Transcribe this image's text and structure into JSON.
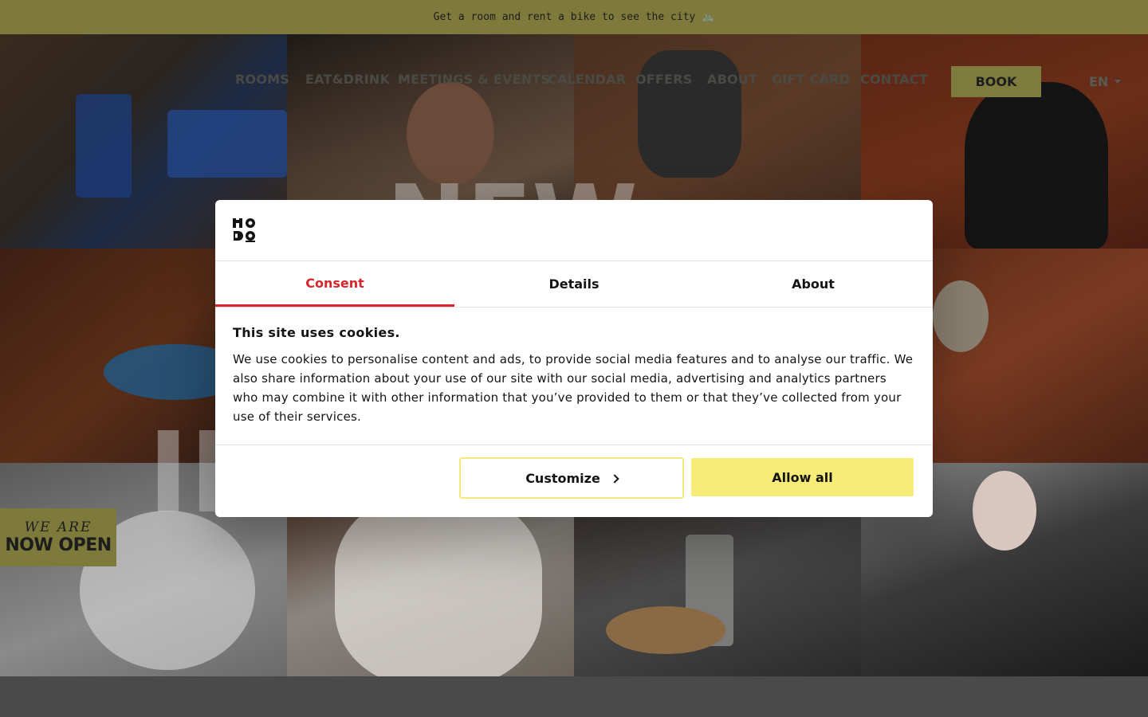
{
  "announcement": {
    "text": "Get a room and rent a bike to see the city 🚲"
  },
  "nav": {
    "items": [
      {
        "label": "ROOMS",
        "name": "nav-rooms"
      },
      {
        "label": "EAT&DRINK",
        "name": "nav-eat-drink"
      },
      {
        "label": "MEETINGS & EVENTS",
        "name": "nav-meetings-events"
      },
      {
        "label": "CALENDAR",
        "name": "nav-calendar"
      },
      {
        "label": "OFFERS",
        "name": "nav-offers"
      },
      {
        "label": "ABOUT",
        "name": "nav-about"
      },
      {
        "label": "GIFT CARD",
        "name": "nav-gift-card"
      },
      {
        "label": "CONTACT",
        "name": "nav-contact"
      }
    ],
    "book_label": "BOOK",
    "language": "EN"
  },
  "badge": {
    "line1": "WE ARE",
    "line2": "NOW OPEN"
  },
  "cookie_dialog": {
    "tabs": [
      {
        "label": "Consent",
        "active": true
      },
      {
        "label": "Details",
        "active": false
      },
      {
        "label": "About",
        "active": false
      }
    ],
    "heading": "This site uses cookies.",
    "body": "We use cookies to personalise content and ads, to provide social media features and to analyse our traffic. We also share information about your use of our site with our social media, advertising and analytics partners who may combine it with other information that you’ve provided to them or that they’ve collected from your use of their services.",
    "customize_label": "Customize",
    "allow_all_label": "Allow all"
  },
  "colors": {
    "accent_yellow": "#f8ec78",
    "active_tab_red": "#d6262b",
    "announcement_bg": "#7d7a3c"
  }
}
